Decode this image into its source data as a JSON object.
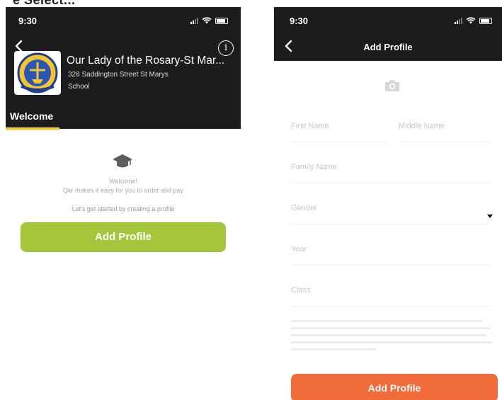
{
  "top_caption": "e Select...",
  "left_screen": {
    "status_time": "9:30",
    "school_name": "Our Lady of the Rosary-St Mar...",
    "school_address": "328 Saddington Street St Marys",
    "school_type": "School",
    "info_symbol": "i",
    "tab_label": "Welcome",
    "tab_indicator_color": "#f2d04a",
    "welcome_title": "Welcome!",
    "welcome_subtitle": "Qkr makes it easy for you to order and pay",
    "get_started": "Let's get started by creating a profile",
    "add_profile_label": "Add Profile",
    "add_profile_color": "#a4c63b",
    "icons": [
      "back-chevron-icon",
      "info-icon",
      "graduation-cap-icon",
      "signal-icon",
      "wifi-icon",
      "battery-icon"
    ]
  },
  "right_screen": {
    "status_time": "9:30",
    "title": "Add Profile",
    "fields": {
      "first_name": "First Name",
      "middle_name": "Middle Name",
      "family_name": "Family Name",
      "gender": "Gender",
      "year": "Year",
      "class": "Class"
    },
    "add_profile_label": "Add Profile",
    "add_profile_color": "#f26b3a",
    "icons": [
      "back-chevron-icon",
      "camera-icon",
      "dropdown-arrow-icon"
    ]
  }
}
